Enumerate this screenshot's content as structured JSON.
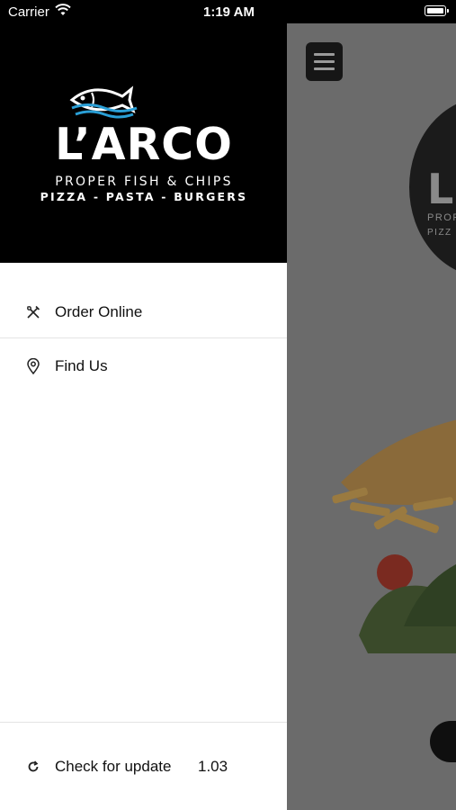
{
  "status_bar": {
    "carrier": "Carrier",
    "time": "1:19 AM"
  },
  "drawer": {
    "brand": {
      "name": "L’ARCO",
      "tagline_1": "PROPER FISH & CHIPS",
      "tagline_2": "PIZZA - PASTA - BURGERS"
    },
    "items": [
      {
        "label": "Order Online",
        "icon": "utensils-icon"
      },
      {
        "label": "Find Us",
        "icon": "map-pin-icon"
      }
    ],
    "footer": {
      "label": "Check for update",
      "icon": "refresh-icon",
      "version": "1.03"
    }
  },
  "background": {
    "logo_partial": {
      "name": "L",
      "sub_1": "PROP",
      "sub_2": "PIZZ"
    }
  },
  "colors": {
    "header_bg": "#000000",
    "drawer_bg": "#ffffff",
    "logo_fish_blue": "#2a9fd6",
    "overlay": "#6b6b6b"
  }
}
